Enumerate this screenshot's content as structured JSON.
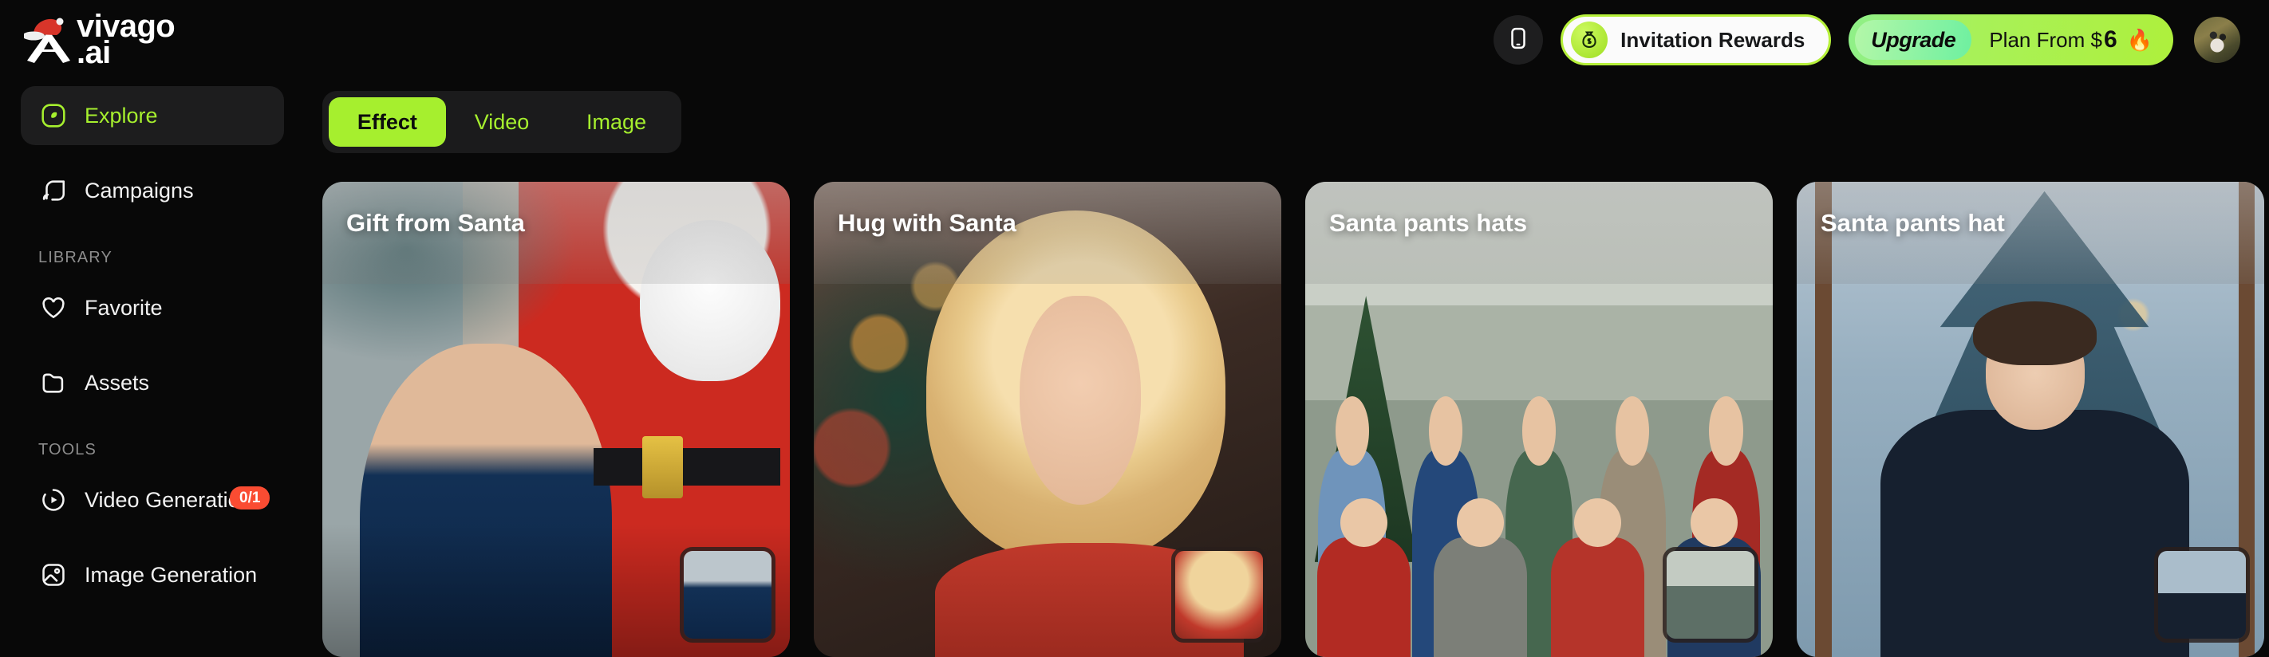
{
  "brand": {
    "name_line1": "vivago",
    "name_line2": ".ai",
    "logo_icon": "santa-hat-triangle-logo"
  },
  "topbar": {
    "mobile_icon": "mobile-phone-icon",
    "invitation": {
      "label": "Invitation Rewards",
      "icon": "money-bag-icon"
    },
    "upgrade": {
      "chip_label": "Upgrade",
      "text_prefix": "Plan From $",
      "price": "6",
      "flame_icon": "🔥"
    },
    "avatar": {
      "icon": "user-avatar"
    }
  },
  "sidebar": {
    "primary": [
      {
        "label": "Explore",
        "icon": "compass-icon",
        "active": true
      },
      {
        "label": "Campaigns",
        "icon": "campaign-broadcast-icon",
        "active": false
      }
    ],
    "library_label": "LIBRARY",
    "library": [
      {
        "label": "Favorite",
        "icon": "heart-icon",
        "active": false
      },
      {
        "label": "Assets",
        "icon": "folder-icon",
        "active": false
      }
    ],
    "tools_label": "TOOLS",
    "tools": [
      {
        "label": "Video Generation",
        "icon": "play-circle-icon",
        "badge": "0/1",
        "active": false
      },
      {
        "label": "Image Generation",
        "icon": "image-icon",
        "badge": "",
        "active": false
      }
    ]
  },
  "main": {
    "tabs": [
      {
        "label": "Effect",
        "active": true
      },
      {
        "label": "Video",
        "active": false
      },
      {
        "label": "Image",
        "active": false
      }
    ],
    "cards": [
      {
        "title": "Gift from Santa",
        "thumb_icon": "source-image-thumbnail"
      },
      {
        "title": "Hug with Santa",
        "thumb_icon": "source-image-thumbnail"
      },
      {
        "title": "Santa pants hats",
        "thumb_icon": "source-image-thumbnail"
      },
      {
        "title": "Santa pants hat",
        "thumb_icon": "source-image-thumbnail"
      }
    ]
  },
  "colors": {
    "accent_green": "#a6ef2e",
    "background": "#080808",
    "badge_red": "#fa4c32",
    "sidebar_active": "#1d1d1e"
  }
}
